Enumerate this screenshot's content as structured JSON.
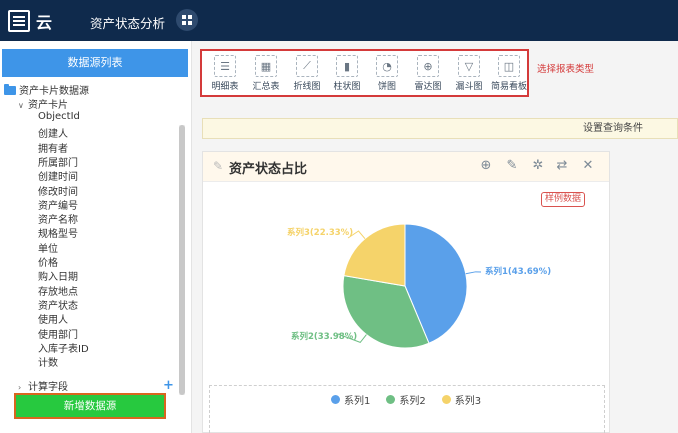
{
  "app": {
    "logo_text": "云",
    "title": "资产状态分析"
  },
  "sidebar": {
    "header": "数据源列表",
    "root_label": "资产卡片数据源",
    "group_label": "资产卡片",
    "fields": [
      "ObjectId",
      "创建人",
      "拥有者",
      "所属部门",
      "创建时间",
      "修改时间",
      "资产编号",
      "资产名称",
      "规格型号",
      "单位",
      "价格",
      "购入日期",
      "存放地点",
      "资产状态",
      "使用人",
      "使用部门",
      "入库子表ID",
      "计数"
    ],
    "collapsed_group_label": "计算字段",
    "add_button": "新增数据源"
  },
  "toolbar": {
    "tools": [
      {
        "label": "明细表",
        "icon": "detail-table-icon",
        "glyph": "☰"
      },
      {
        "label": "汇总表",
        "icon": "summary-table-icon",
        "glyph": "▦"
      },
      {
        "label": "折线图",
        "icon": "line-chart-icon",
        "glyph": "⟋"
      },
      {
        "label": "柱状图",
        "icon": "bar-chart-icon",
        "glyph": "▮"
      },
      {
        "label": "饼图",
        "icon": "pie-chart-icon",
        "glyph": "◔"
      },
      {
        "label": "雷达图",
        "icon": "radar-chart-icon",
        "glyph": "⊕"
      },
      {
        "label": "漏斗图",
        "icon": "funnel-chart-icon",
        "glyph": "▽"
      },
      {
        "label": "简易看板",
        "icon": "dashboard-icon",
        "glyph": "◫"
      }
    ],
    "hint": "选择报表类型"
  },
  "query_bar": {
    "label": "设置查询条件"
  },
  "panel": {
    "title": "资产状态占比",
    "badge": "样例数据"
  },
  "chart_data": {
    "type": "pie",
    "slices": [
      {
        "name": "系列1",
        "percent": 43.69,
        "label": "系列1(43.69%)",
        "color": "#5aa0ea"
      },
      {
        "name": "系列2",
        "percent": 33.98,
        "label": "系列2(33.98%)",
        "color": "#6fbf84"
      },
      {
        "name": "系列3",
        "percent": 22.33,
        "label": "系列3(22.33%)",
        "color": "#f5d36a"
      }
    ],
    "legend": [
      "系列1",
      "系列2",
      "系列3"
    ],
    "legend_position": "bottom"
  },
  "colors": {
    "topbar": "#0f2a4c",
    "accent_blue": "#3e95e8",
    "add_button": "#27c93f",
    "highlight_red": "#d43a3a"
  }
}
